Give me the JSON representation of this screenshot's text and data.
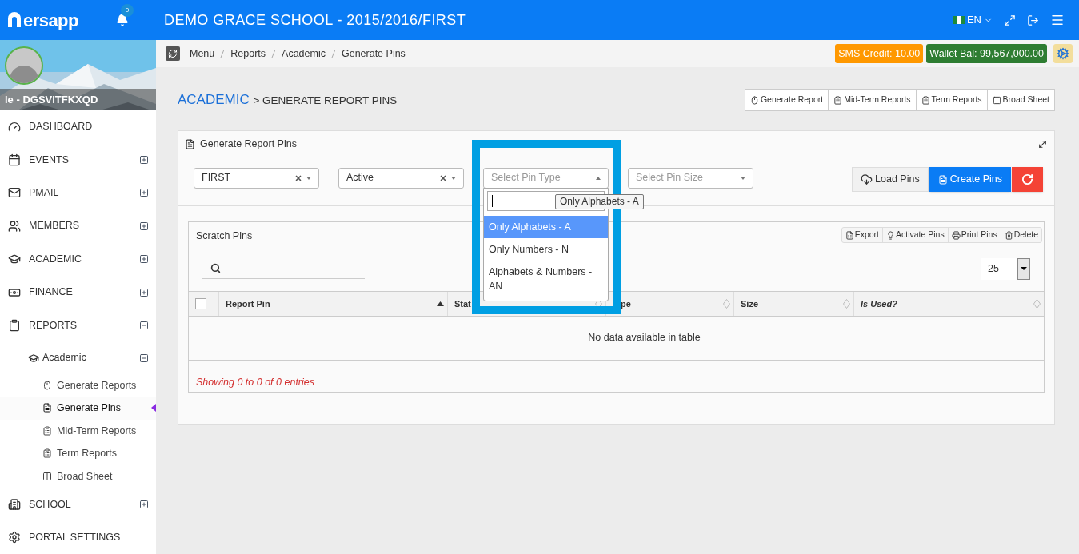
{
  "topbar": {
    "logo": "ersapp",
    "notifications": "0",
    "title": "DEMO GRACE SCHOOL - 2015/2016/FIRST",
    "language": "EN"
  },
  "profile": {
    "name": "le - DGSVITFKXQD"
  },
  "sidebar": {
    "items": [
      {
        "label": "DASHBOARD"
      },
      {
        "label": "EVENTS",
        "expanded": false
      },
      {
        "label": "PMAIL",
        "expanded": false
      },
      {
        "label": "MEMBERS",
        "expanded": false
      },
      {
        "label": "ACADEMIC",
        "expanded": false
      },
      {
        "label": "FINANCE",
        "expanded": false
      },
      {
        "label": "REPORTS",
        "expanded": true,
        "children": [
          {
            "label": "Academic",
            "expanded": true,
            "children": [
              {
                "label": "Generate Reports",
                "selected": false
              },
              {
                "label": "Generate Pins",
                "selected": true
              },
              {
                "label": "Mid-Term Reports",
                "selected": false
              },
              {
                "label": "Term Reports",
                "selected": false
              },
              {
                "label": "Broad Sheet",
                "selected": false
              }
            ]
          }
        ]
      },
      {
        "label": "SCHOOL",
        "expanded": false
      },
      {
        "label": "PORTAL SETTINGS"
      }
    ]
  },
  "breadcrumb": [
    "Menu",
    "Reports",
    "Academic",
    "Generate Pins"
  ],
  "badges": [
    {
      "text": "SMS Credit: 10.00",
      "color": "#ff9800"
    },
    {
      "text": "Wallet Bal: 99,567,000.00",
      "color": "#2e7d32"
    }
  ],
  "page_title": {
    "section": "ACADEMIC",
    "rest": "> GENERATE REPORT PINS"
  },
  "report_links": [
    "Generate Report",
    "Mid-Term Reports",
    "Term Reports",
    "Broad Sheet"
  ],
  "panel": {
    "title": "Generate Report Pins",
    "filters": [
      {
        "value": "FIRST",
        "clearable": true,
        "open": false
      },
      {
        "value": "Active",
        "clearable": true,
        "open": false
      },
      {
        "placeholder": "Select Pin Type",
        "clearable": false,
        "open": true
      },
      {
        "placeholder": "Select Pin Size",
        "clearable": false,
        "open": false
      }
    ],
    "dropdown": {
      "options": [
        {
          "label": "Only Alphabets - A",
          "selected": true
        },
        {
          "label": "Only Numbers - N",
          "selected": false
        },
        {
          "label": "Alphabets & Numbers - AN",
          "selected": false
        }
      ],
      "tooltip": "Only Alphabets - A"
    },
    "actions": [
      {
        "label": "Load Pins",
        "kind": "load"
      },
      {
        "label": "Create Pins",
        "kind": "create"
      },
      {
        "kind": "refresh"
      }
    ],
    "table": {
      "title": "Scratch Pins",
      "tools": [
        "Export",
        "Activate Pins",
        "Print Pins",
        "Delete"
      ],
      "page_size": "25",
      "select_all": {
        "checked": false
      },
      "columns": [
        {
          "label": "Report Pin",
          "sorted": true,
          "italic": false
        },
        {
          "label": "Stat",
          "sorted": false,
          "italic": false
        },
        {
          "label": "pe",
          "sorted": false,
          "italic": false
        },
        {
          "label": "Size",
          "sorted": false,
          "italic": false
        },
        {
          "label": "Is Used?",
          "sorted": false,
          "italic": true
        }
      ],
      "empty": "No data available in table",
      "info": "Showing 0 to 0 of 0 entries"
    }
  }
}
